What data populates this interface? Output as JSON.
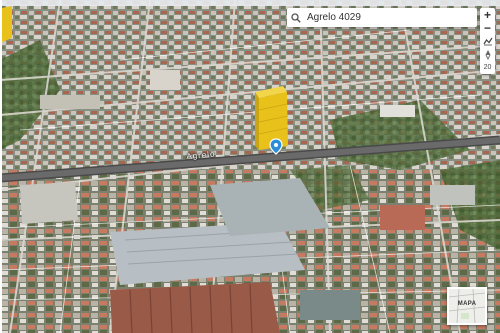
{
  "search": {
    "value": "Agrelo 4029",
    "placeholder": ""
  },
  "zoom": {
    "in_label": "+",
    "out_label": "−",
    "level": "20"
  },
  "street": {
    "label": "Agrelo"
  },
  "minimap": {
    "label": "MAPA"
  },
  "icons": {
    "search": "search-icon",
    "pin": "location-pin-icon",
    "tilt": "tilt-icon",
    "building": "building-marker-icon"
  },
  "colors": {
    "building_marker": "#e8c11a",
    "pin": "#2a8fd6",
    "street_text": "#ffffff"
  }
}
